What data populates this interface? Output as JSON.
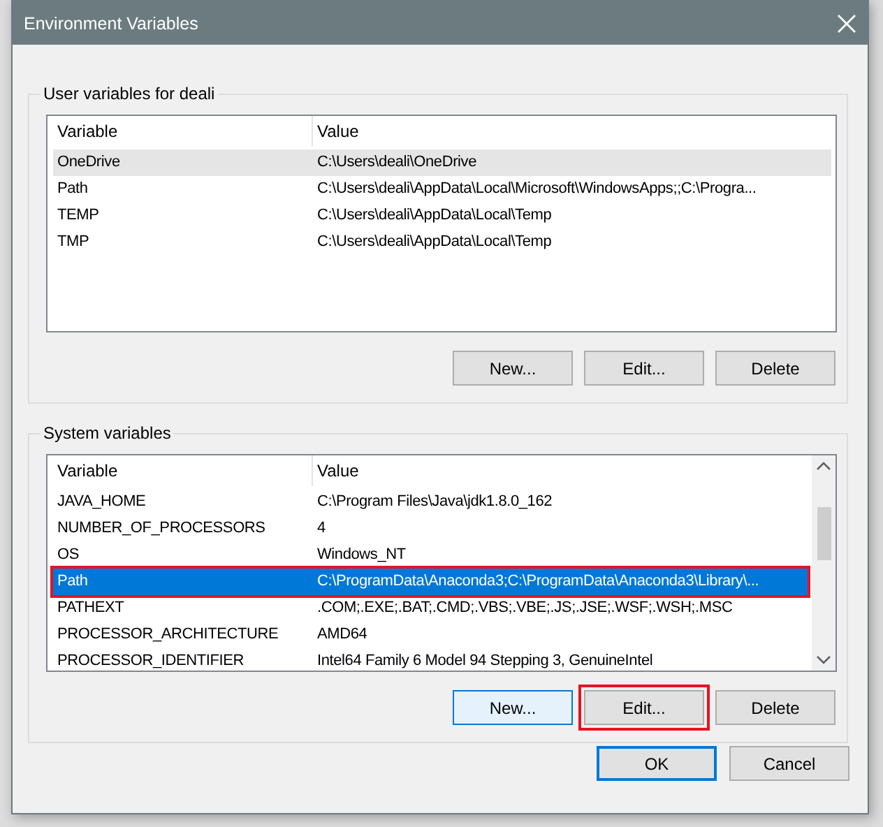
{
  "window": {
    "title": "Environment Variables"
  },
  "groups": [
    {
      "title": "User variables for deali",
      "focused": false,
      "scrollbar": false,
      "columns": [
        "Variable",
        "Value"
      ],
      "rows": [
        {
          "variable": "OneDrive",
          "value": "C:\\Users\\deali\\OneDrive",
          "selected": true,
          "highlighted": false
        },
        {
          "variable": "Path",
          "value": "C:\\Users\\deali\\AppData\\Local\\Microsoft\\WindowsApps;;C:\\Progra...",
          "selected": false,
          "highlighted": false
        },
        {
          "variable": "TEMP",
          "value": "C:\\Users\\deali\\AppData\\Local\\Temp",
          "selected": false,
          "highlighted": false
        },
        {
          "variable": "TMP",
          "value": "C:\\Users\\deali\\AppData\\Local\\Temp",
          "selected": false,
          "highlighted": false
        }
      ],
      "buttons": [
        {
          "label": "New...",
          "default": false,
          "hovered": false,
          "highlighted": false
        },
        {
          "label": "Edit...",
          "default": false,
          "hovered": false,
          "highlighted": false
        },
        {
          "label": "Delete",
          "default": false,
          "hovered": false,
          "highlighted": false
        }
      ]
    },
    {
      "title": "System variables",
      "focused": true,
      "scrollbar": true,
      "columns": [
        "Variable",
        "Value"
      ],
      "rows": [
        {
          "variable": "JAVA_HOME",
          "value": "C:\\Program Files\\Java\\jdk1.8.0_162",
          "selected": false,
          "highlighted": false
        },
        {
          "variable": "NUMBER_OF_PROCESSORS",
          "value": "4",
          "selected": false,
          "highlighted": false
        },
        {
          "variable": "OS",
          "value": "Windows_NT",
          "selected": false,
          "highlighted": false
        },
        {
          "variable": "Path",
          "value": "C:\\ProgramData\\Anaconda3;C:\\ProgramData\\Anaconda3\\Library\\...",
          "selected": true,
          "highlighted": true
        },
        {
          "variable": "PATHEXT",
          "value": ".COM;.EXE;.BAT;.CMD;.VBS;.VBE;.JS;.JSE;.WSF;.WSH;.MSC",
          "selected": false,
          "highlighted": false
        },
        {
          "variable": "PROCESSOR_ARCHITECTURE",
          "value": "AMD64",
          "selected": false,
          "highlighted": false
        },
        {
          "variable": "PROCESSOR_IDENTIFIER",
          "value": "Intel64 Family 6 Model 94 Stepping 3, GenuineIntel",
          "selected": false,
          "highlighted": false
        }
      ],
      "buttons": [
        {
          "label": "New...",
          "default": false,
          "hovered": true,
          "highlighted": false
        },
        {
          "label": "Edit...",
          "default": false,
          "hovered": false,
          "highlighted": true
        },
        {
          "label": "Delete",
          "default": false,
          "hovered": false,
          "highlighted": false
        }
      ]
    }
  ],
  "buttons": [
    {
      "label": "OK",
      "default": true,
      "hovered": false,
      "highlighted": false
    },
    {
      "label": "Cancel",
      "default": false,
      "hovered": false,
      "highlighted": false
    }
  ]
}
